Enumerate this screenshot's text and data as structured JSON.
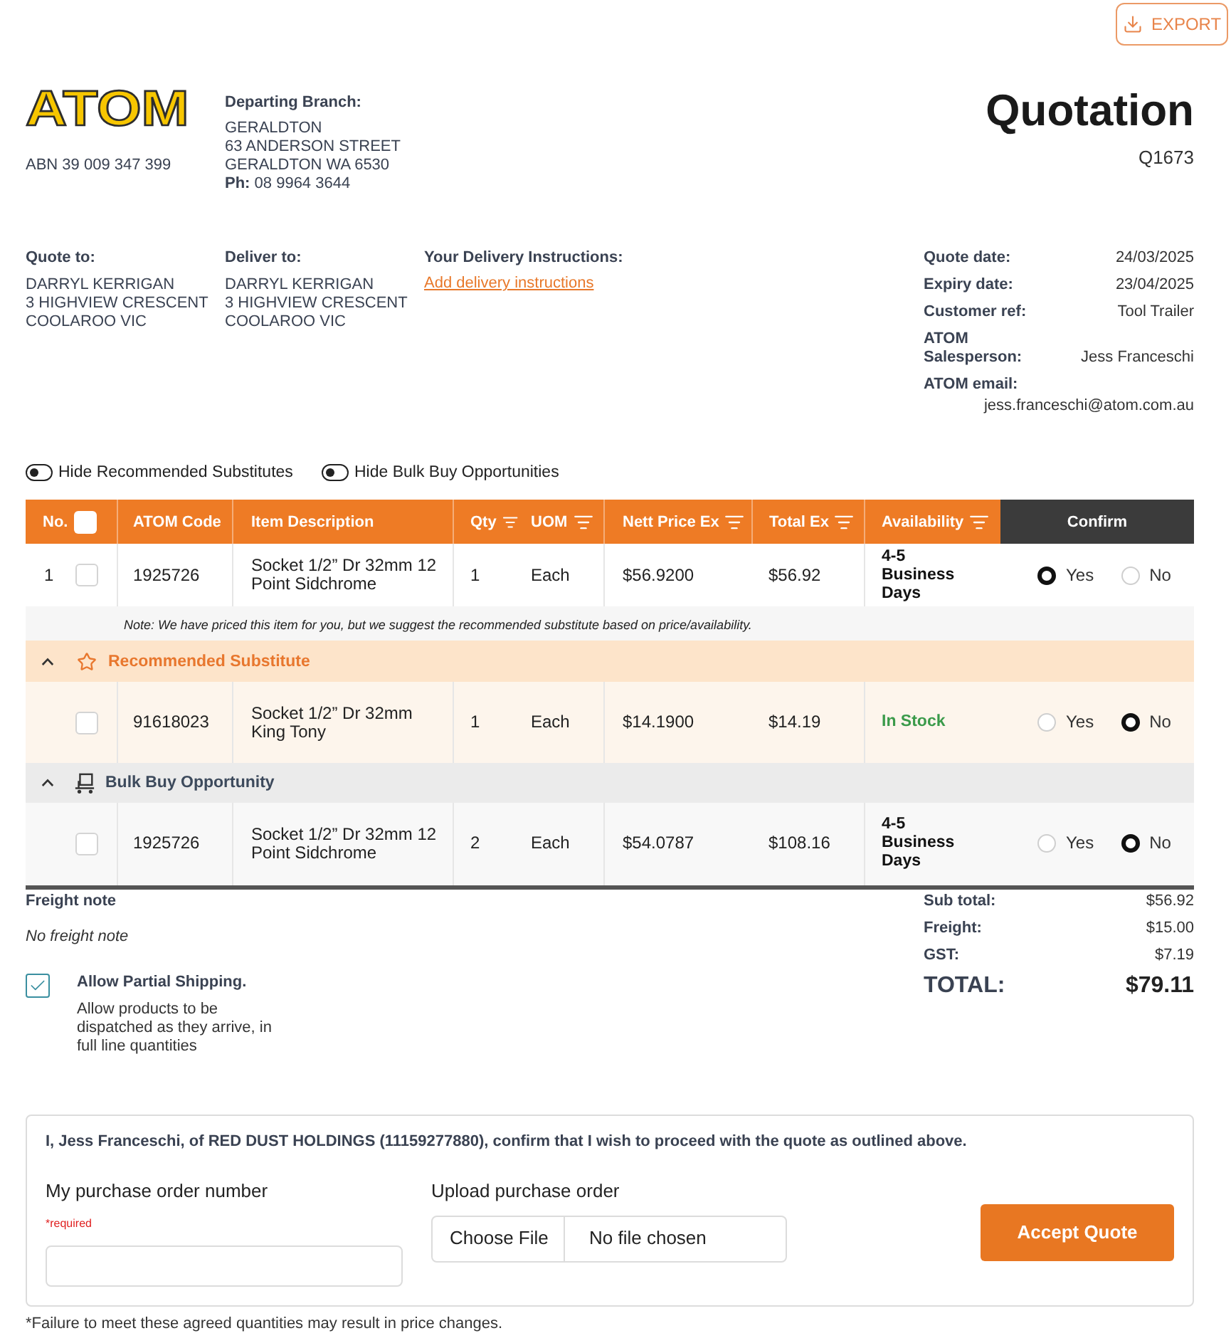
{
  "export_button": {
    "label": "EXPORT"
  },
  "company": {
    "logo": "ATOM",
    "abn": "ABN 39 009 347 399"
  },
  "departing_branch": {
    "heading": "Departing Branch:",
    "lines": [
      "GERALDTON",
      "63 ANDERSON STREET",
      "GERALDTON WA 6530",
      "**Ph:** 08 9964 3644"
    ]
  },
  "document": {
    "title": "Quotation",
    "number": "Q1673"
  },
  "addresses": [
    {
      "heading": "Quote to:",
      "lines": [
        "DARRYL KERRIGAN",
        "3 HIGHVIEW CRESCENT",
        "COOLAROO VIC"
      ]
    },
    {
      "heading": "Deliver to:",
      "lines": [
        "DARRYL KERRIGAN",
        "3 HIGHVIEW CRESCENT",
        "COOLAROO VIC"
      ]
    }
  ],
  "delivery_instructions": {
    "heading": "Your Delivery Instructions:",
    "link": "Add delivery instructions"
  },
  "details": [
    {
      "kind": "inline",
      "label": "Quote date:",
      "value": "24/03/2025"
    },
    {
      "kind": "inline",
      "label": "Expiry date:",
      "value": "23/04/2025"
    },
    {
      "kind": "inline",
      "label": "Customer ref:",
      "value": "Tool Trailer"
    },
    {
      "kind": "inline",
      "label": "ATOM Salesperson:",
      "value": "Jess Franceschi"
    },
    {
      "kind": "stacked",
      "label": "ATOM email:",
      "value": "jess.franceschi@atom.com.au"
    }
  ],
  "toggles": [
    {
      "label": "Hide Recommended Substitutes",
      "on": false
    },
    {
      "label": "Hide Bulk Buy Opportunities",
      "on": false
    }
  ],
  "table": {
    "select_all": {
      "checked": false
    },
    "columns": [
      {
        "label": "No."
      },
      {
        "label": "ATOM Code"
      },
      {
        "label": "Item Description"
      },
      {
        "label": "Qty",
        "filter": true
      },
      {
        "label": "UOM",
        "filter": true
      },
      {
        "label": "Nett Price Ex",
        "filter": true
      },
      {
        "label": "Total Ex",
        "filter": true
      },
      {
        "label": "Availability",
        "filter": true
      },
      {
        "label": "Confirm",
        "dark": true
      }
    ],
    "rows": [
      {
        "kind": "item",
        "number": "1",
        "checked": false,
        "code": "1925726",
        "description": "Socket 1/2” Dr 32mm 12 Point Sidchrome",
        "qty": "1",
        "uom": "Each",
        "nett_price": "$56.9200",
        "total": "$56.92",
        "availability": "4-5 Business Days",
        "in_stock": false,
        "confirm": [
          {
            "label": "Yes",
            "selected": true
          },
          {
            "label": "No",
            "selected": false
          }
        ]
      },
      {
        "kind": "note",
        "text": "Note: We have priced this item for you, but we suggest the recommended substitute based on price/availability."
      },
      {
        "kind": "substitute_group",
        "label": "Recommended Substitute",
        "expanded": true
      },
      {
        "kind": "substitute_item",
        "checked": false,
        "code": "91618023",
        "description": "Socket 1/2” Dr 32mm King Tony",
        "qty": "1",
        "uom": "Each",
        "nett_price": "$14.1900",
        "total": "$14.19",
        "availability": "In Stock",
        "in_stock": true,
        "confirm": [
          {
            "label": "Yes",
            "selected": false
          },
          {
            "label": "No",
            "selected": true
          }
        ]
      },
      {
        "kind": "bulk_group",
        "label": "Bulk Buy Opportunity",
        "expanded": true
      },
      {
        "kind": "bulk_item",
        "checked": false,
        "code": "1925726",
        "description": "Socket 1/2” Dr 32mm 12 Point Sidchrome",
        "qty": "2",
        "uom": "Each",
        "nett_price": "$54.0787",
        "total": "$108.16",
        "availability": "4-5 Business Days",
        "in_stock": false,
        "confirm": [
          {
            "label": "Yes",
            "selected": false
          },
          {
            "label": "No",
            "selected": true
          }
        ]
      }
    ]
  },
  "freight": {
    "heading": "Freight note",
    "text": "No freight note"
  },
  "partial_shipping": {
    "checked": true,
    "title": "Allow Partial Shipping.",
    "description": "Allow products to be dispatched as they arrive, in full line quantities"
  },
  "totals": [
    {
      "kind": "line",
      "label": "Sub total:",
      "value": "$56.92"
    },
    {
      "kind": "line",
      "label": "Freight:",
      "value": "$15.00"
    },
    {
      "kind": "line",
      "label": "GST:",
      "value": "$7.19"
    },
    {
      "kind": "grand",
      "label": "TOTAL:",
      "value": "$79.11"
    }
  ],
  "acceptance": {
    "statement": "I, Jess Franceschi, of RED DUST HOLDINGS (11159277880), confirm that I wish to proceed with the quote as outlined above.",
    "po_label": "My purchase order number",
    "required": "*required",
    "upload_label": "Upload purchase order",
    "choose_file": "Choose File",
    "no_file": "No file chosen",
    "button": "Accept Quote"
  },
  "footnote": "*Failure to meet these agreed quantities may result in price changes."
}
